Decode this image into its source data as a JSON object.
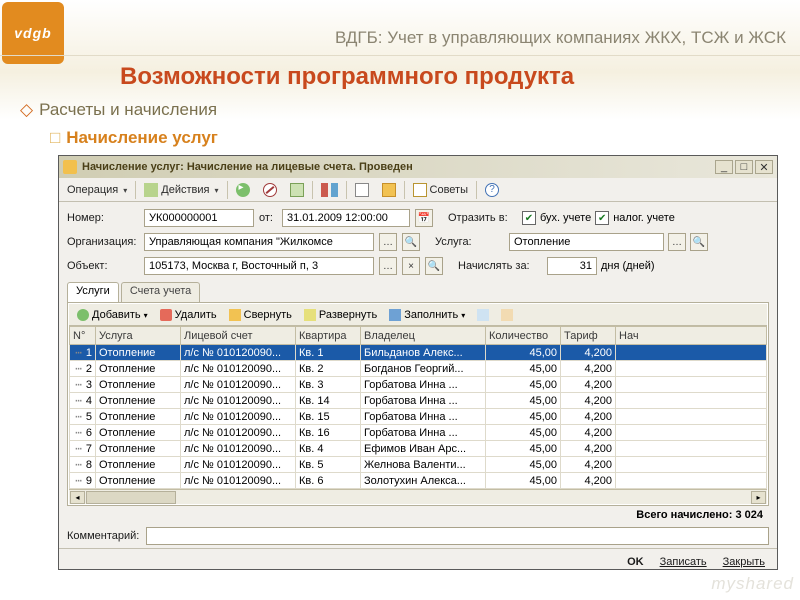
{
  "brand": "ВДГБ: Учет в управляющих компаниях ЖКХ, ТСЖ и ЖСК",
  "logo_text": "vdgb",
  "headline": "Возможности программного продукта",
  "bullet1": "Расчеты и начисления",
  "bullet2": "Начисление услуг",
  "watermark": "myshared",
  "window": {
    "title": "Начисление услуг: Начисление на лицевые счета. Проведен",
    "toolbar": {
      "operation": "Операция",
      "actions": "Действия",
      "tips": "Советы"
    },
    "form": {
      "number_lbl": "Номер:",
      "number_val": "УК000000001",
      "date_lbl": "от:",
      "date_val": "31.01.2009 12:00:00",
      "reflect_lbl": "Отразить в:",
      "reflect_bu": "бух. учете",
      "reflect_nu": "налог. учете",
      "org_lbl": "Организация:",
      "org_val": "Управляющая компания \"Жилкомсе",
      "service_lbl": "Услуга:",
      "service_val": "Отопление",
      "obj_lbl": "Объект:",
      "obj_val": "105173, Москва г, Восточный п, 3",
      "accrue_lbl": "Начислять за:",
      "accrue_days": "31",
      "accrue_unit": "дня (дней)"
    },
    "tabs": {
      "t1": "Услуги",
      "t2": "Счета учета"
    },
    "grid_tb": {
      "add": "Добавить",
      "del": "Удалить",
      "collapse": "Свернуть",
      "expand": "Развернуть",
      "fill": "Заполнить"
    },
    "columns": [
      "N°",
      "Услуга",
      "Лицевой счет",
      "Квартира",
      "Владелец",
      "Количество",
      "Тариф",
      "Нач"
    ],
    "rows": [
      {
        "n": "1",
        "u": "Отопление",
        "ls": "л/с № 010120090...",
        "kv": "Кв. 1",
        "o": "Бильданов Алекс...",
        "q": "45,00",
        "t": "4,200"
      },
      {
        "n": "2",
        "u": "Отопление",
        "ls": "л/с № 010120090...",
        "kv": "Кв. 2",
        "o": "Богданов Георгий...",
        "q": "45,00",
        "t": "4,200"
      },
      {
        "n": "3",
        "u": "Отопление",
        "ls": "л/с № 010120090...",
        "kv": "Кв. 3",
        "o": "Горбатова Инна ...",
        "q": "45,00",
        "t": "4,200"
      },
      {
        "n": "4",
        "u": "Отопление",
        "ls": "л/с № 010120090...",
        "kv": "Кв. 14",
        "o": "Горбатова Инна ...",
        "q": "45,00",
        "t": "4,200"
      },
      {
        "n": "5",
        "u": "Отопление",
        "ls": "л/с № 010120090...",
        "kv": "Кв. 15",
        "o": "Горбатова Инна ...",
        "q": "45,00",
        "t": "4,200"
      },
      {
        "n": "6",
        "u": "Отопление",
        "ls": "л/с № 010120090...",
        "kv": "Кв. 16",
        "o": "Горбатова Инна ...",
        "q": "45,00",
        "t": "4,200"
      },
      {
        "n": "7",
        "u": "Отопление",
        "ls": "л/с № 010120090...",
        "kv": "Кв. 4",
        "o": "Ефимов Иван Арс...",
        "q": "45,00",
        "t": "4,200"
      },
      {
        "n": "8",
        "u": "Отопление",
        "ls": "л/с № 010120090...",
        "kv": "Кв. 5",
        "o": "Желнова Валенти...",
        "q": "45,00",
        "t": "4,200"
      },
      {
        "n": "9",
        "u": "Отопление",
        "ls": "л/с № 010120090...",
        "kv": "Кв. 6",
        "o": "Золотухин Алекса...",
        "q": "45,00",
        "t": "4,200"
      }
    ],
    "total_lbl": "Всего начислено: 3 024",
    "comment_lbl": "Комментарий:",
    "footer": {
      "ok": "OK",
      "save": "Записать",
      "close": "Закрыть"
    }
  }
}
